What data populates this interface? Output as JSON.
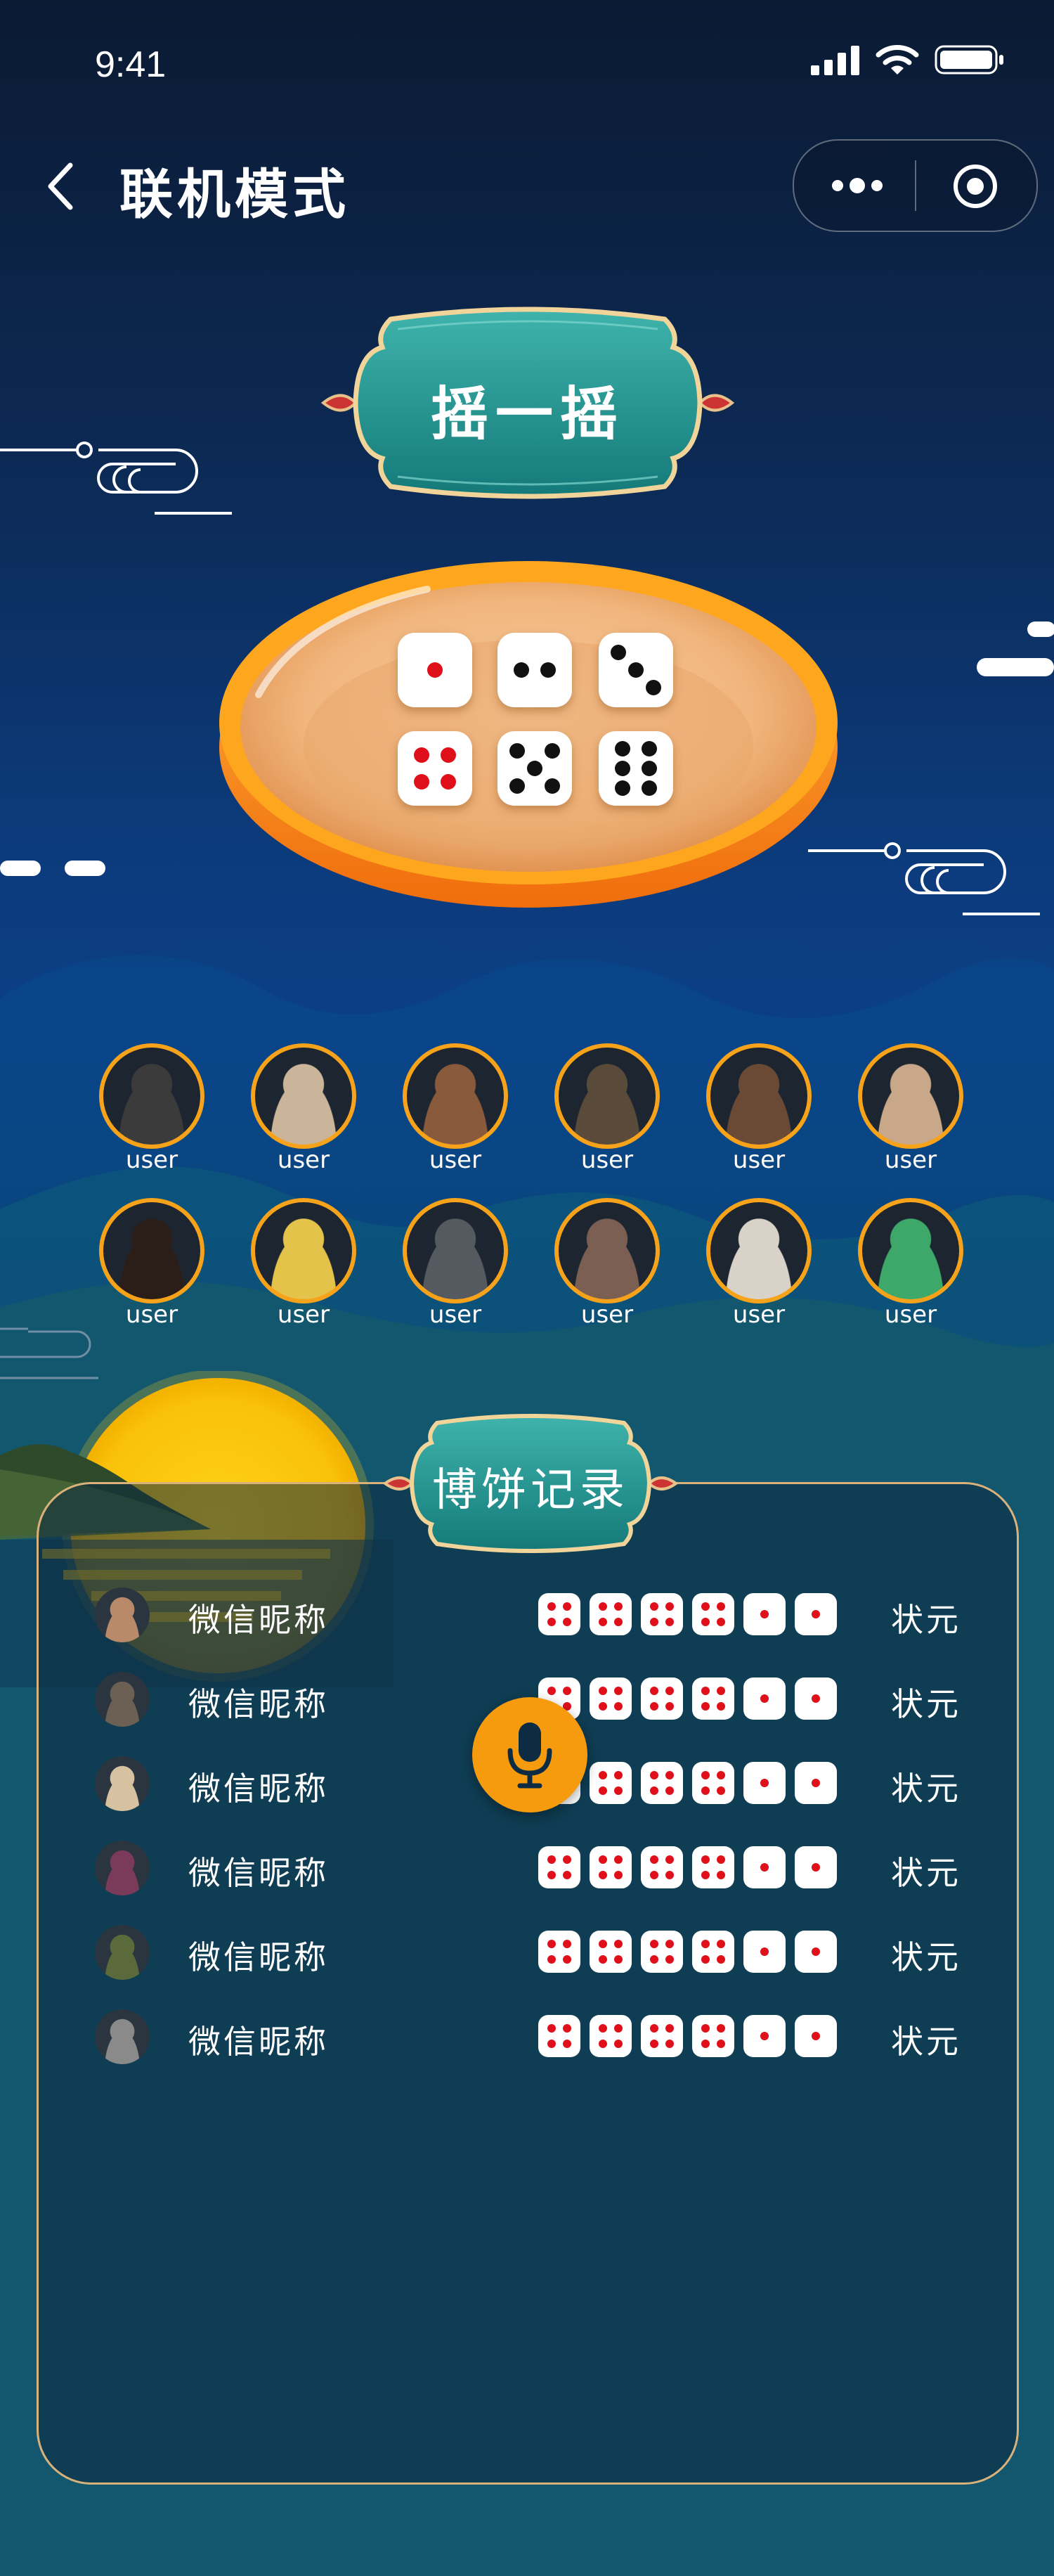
{
  "status_bar": {
    "time": "9:41"
  },
  "nav": {
    "title": "联机模式"
  },
  "shake_banner": {
    "label": "摇一摇"
  },
  "bowl_dice": [
    1,
    2,
    3,
    4,
    5,
    6
  ],
  "players": [
    {
      "name": "user",
      "tone": "#3b3b3b"
    },
    {
      "name": "user",
      "tone": "#cbb59a"
    },
    {
      "name": "user",
      "tone": "#8a5a3c"
    },
    {
      "name": "user",
      "tone": "#5a4a3a"
    },
    {
      "name": "user",
      "tone": "#6b4a35"
    },
    {
      "name": "user",
      "tone": "#c9a88a"
    },
    {
      "name": "user",
      "tone": "#2b1e18"
    },
    {
      "name": "user",
      "tone": "#e3c34a"
    },
    {
      "name": "user",
      "tone": "#555a60"
    },
    {
      "name": "user",
      "tone": "#7a5f52"
    },
    {
      "name": "user",
      "tone": "#d9d2c8"
    },
    {
      "name": "user",
      "tone": "#3da86a"
    }
  ],
  "records": {
    "title": "博饼记录",
    "rows": [
      {
        "name": "微信昵称",
        "dice": [
          4,
          4,
          4,
          4,
          1,
          1
        ],
        "result": "状元",
        "tone": "#b88a6a"
      },
      {
        "name": "微信昵称",
        "dice": [
          4,
          4,
          4,
          4,
          1,
          1
        ],
        "result": "状元",
        "tone": "#6c6055"
      },
      {
        "name": "微信昵称",
        "dice": [
          4,
          4,
          4,
          4,
          1,
          1
        ],
        "result": "状元",
        "tone": "#d6c1a1"
      },
      {
        "name": "微信昵称",
        "dice": [
          4,
          4,
          4,
          4,
          1,
          1
        ],
        "result": "状元",
        "tone": "#7a3a5a"
      },
      {
        "name": "微信昵称",
        "dice": [
          4,
          4,
          4,
          4,
          1,
          1
        ],
        "result": "状元",
        "tone": "#5a6a3a"
      },
      {
        "name": "微信昵称",
        "dice": [
          4,
          4,
          4,
          4,
          1,
          1
        ],
        "result": "状元",
        "tone": "#8a8a8a"
      }
    ]
  },
  "colors": {
    "accent": "#f79b0e",
    "teal": "#1f8f8c",
    "gold": "#d8b27a",
    "dot_red": "#e0101a"
  }
}
